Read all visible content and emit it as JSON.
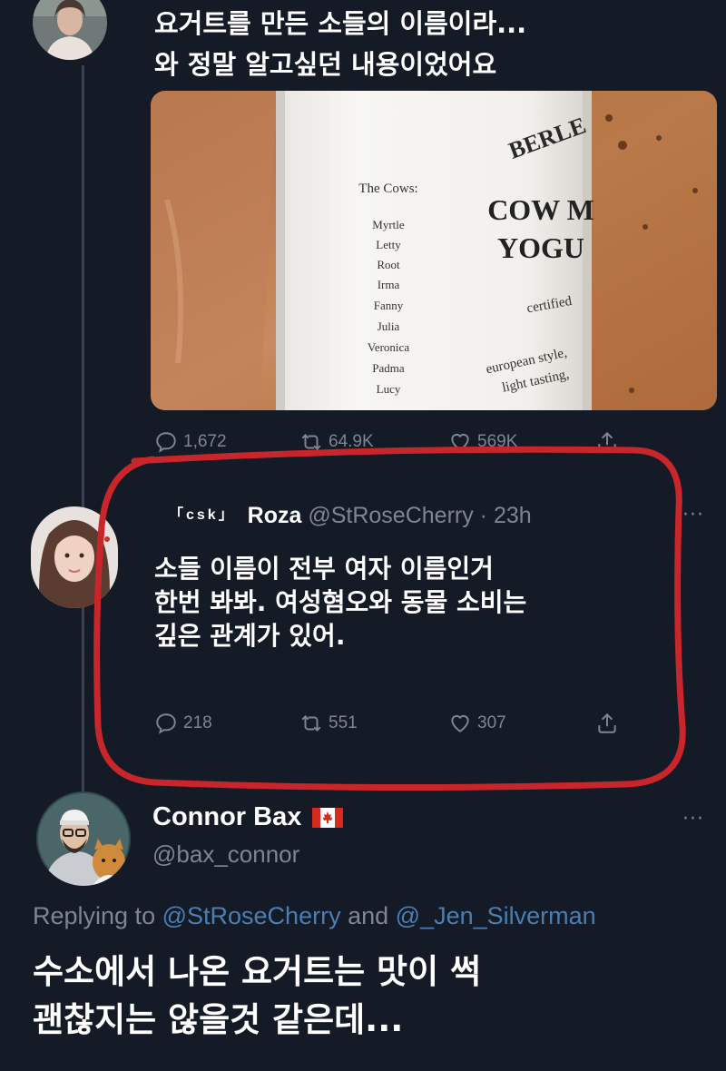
{
  "top_tweet": {
    "text_line1": "요거트를 만든 소들의 이름이라...",
    "text_line2": "와 정말 알고싶던 내용이었어요",
    "image": {
      "label_heading": "The Cows:",
      "cow_names": [
        "Myrtle",
        "Letty",
        "Root",
        "Irma",
        "Fanny",
        "Julia",
        "Veronica",
        "Padma",
        "Lucy"
      ],
      "brand": "BERLE",
      "product_line1": "COW M",
      "product_line2": "YOGU",
      "certified": "certified",
      "style_line1": "european style,",
      "style_line2": "light tasting,"
    },
    "actions": {
      "replies": "1,672",
      "retweets": "64.9K",
      "likes": "569K"
    }
  },
  "quoted_tweet": {
    "badge": "「csk」",
    "name": "Roza",
    "handle": "@StRoseCherry",
    "time": "· 23h",
    "more": "···",
    "text_line1": "소들 이름이 전부 여자 이름인거",
    "text_line2": "한번 봐봐. 여성혐오와 동물 소비는",
    "text_line3": "깊은 관계가 있어.",
    "actions": {
      "replies": "218",
      "retweets": "551",
      "likes": "307"
    }
  },
  "reply_tweet": {
    "name": "Connor Bax",
    "handle": "@bax_connor",
    "more": "···",
    "replying_prefix": "Replying to",
    "replying_user1": "@StRoseCherry",
    "replying_and": "and",
    "replying_user2": "@_Jen_Silverman",
    "text_line1": "수소에서 나온 요거트는 맛이 썩",
    "text_line2": "괜찮지는 않을것 같은데..."
  },
  "icons": {
    "reply": "reply-icon",
    "retweet": "retweet-icon",
    "like": "heart-icon",
    "share": "share-icon",
    "flag": "canada-flag-icon"
  },
  "colors": {
    "background": "#141a26",
    "muted": "#7d8696",
    "link": "#4b7fb3",
    "highlight": "#c8262b"
  }
}
